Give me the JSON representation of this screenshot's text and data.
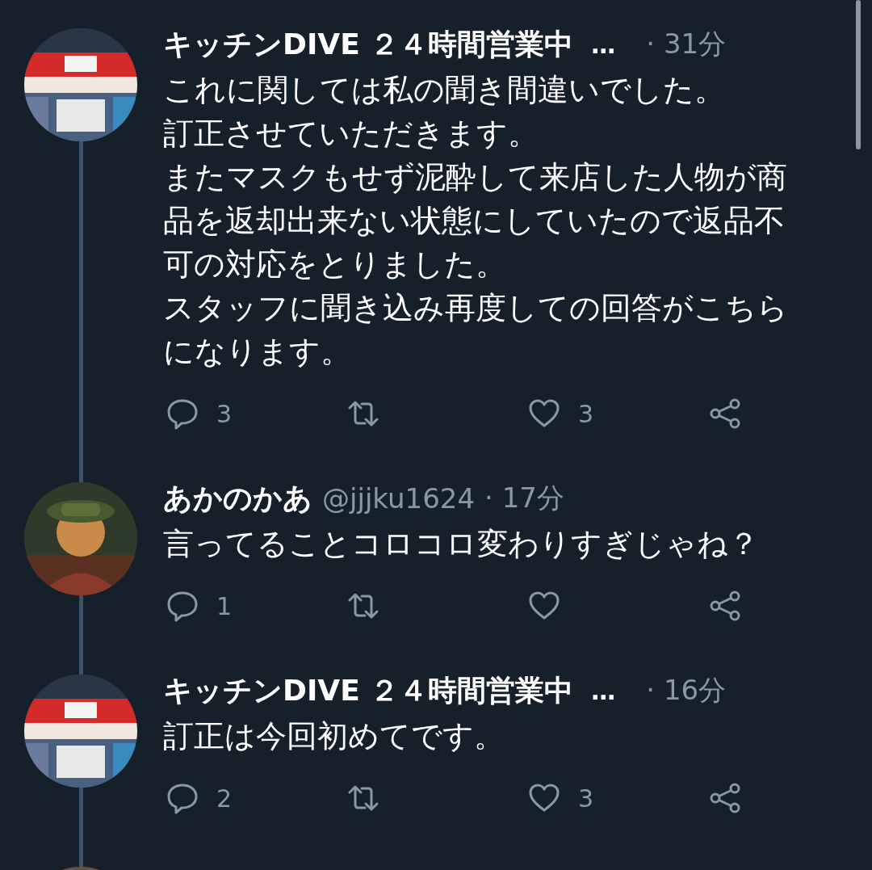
{
  "tweets": [
    {
      "kind": "full",
      "author": "キッチンDIVE ２４時間営業中",
      "truncation": "…",
      "time": "· 31分",
      "text": [
        "これに関しては私の聞き間違いでした。",
        "訂正させていただきます。",
        "またマスクもせず泥酔して来店した人物が商品を返却出来ない状態にしていたので返品不可の対応をとりました。",
        "スタッフに聞き込み再度しての回答がこちらになります。"
      ],
      "replies": "3",
      "likes": "3"
    },
    {
      "kind": "full",
      "author": "あかのかあ",
      "handle": "@jjjku1624",
      "time": "· 17分",
      "text": [
        "言ってることコロコロ変わりすぎじゃね？"
      ],
      "replies": "1"
    },
    {
      "kind": "full",
      "author": "キッチンDIVE ２４時間営業中",
      "truncation": "…",
      "time": "· 16分",
      "text": [
        "訂正は今回初めてです。"
      ],
      "replies": "2",
      "likes": "3"
    },
    {
      "kind": "partial"
    }
  ]
}
